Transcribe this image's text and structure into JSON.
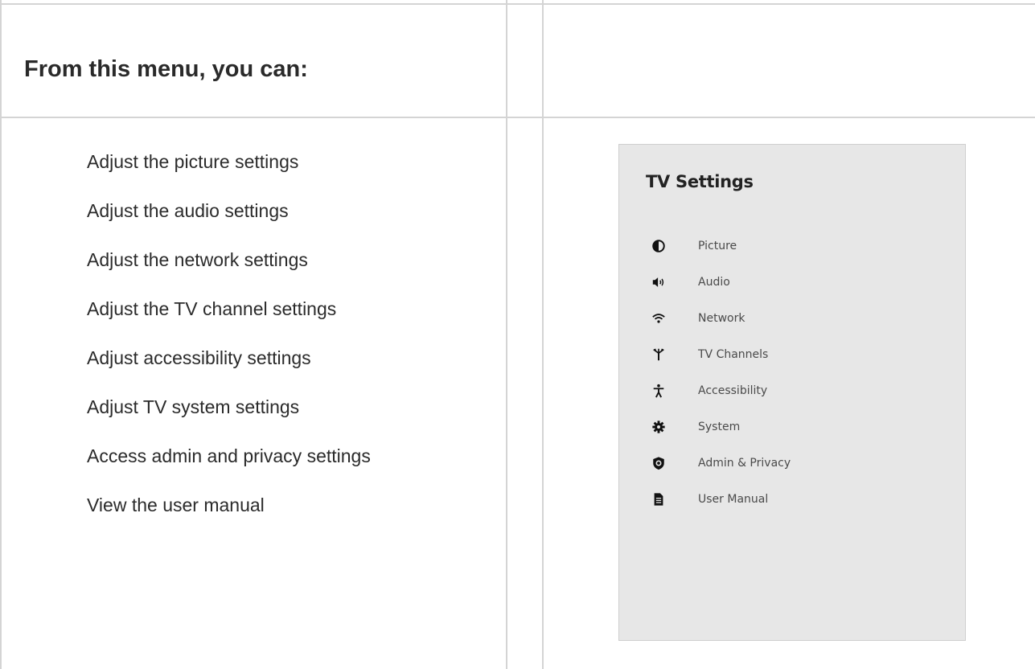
{
  "table": {
    "heading": "From this menu, you can:"
  },
  "abilities": [
    "Adjust the picture settings",
    "Adjust the audio settings",
    "Adjust the network settings",
    "Adjust the TV channel settings",
    "Adjust accessibility settings",
    "Adjust TV system settings",
    "Access admin and privacy settings",
    "View the user manual"
  ],
  "tv_settings": {
    "title": "TV Settings",
    "items": [
      {
        "label": "Picture",
        "icon": "picture-icon"
      },
      {
        "label": "Audio",
        "icon": "audio-icon"
      },
      {
        "label": "Network",
        "icon": "wifi-icon"
      },
      {
        "label": "TV Channels",
        "icon": "antenna-icon"
      },
      {
        "label": "Accessibility",
        "icon": "accessibility-icon"
      },
      {
        "label": "System",
        "icon": "gear-icon"
      },
      {
        "label": "Admin & Privacy",
        "icon": "shield-icon"
      },
      {
        "label": "User Manual",
        "icon": "manual-icon"
      }
    ]
  },
  "colors": {
    "grid_line": "#d4d4d4",
    "panel_bg": "#e7e7e7",
    "text": "#222222"
  }
}
